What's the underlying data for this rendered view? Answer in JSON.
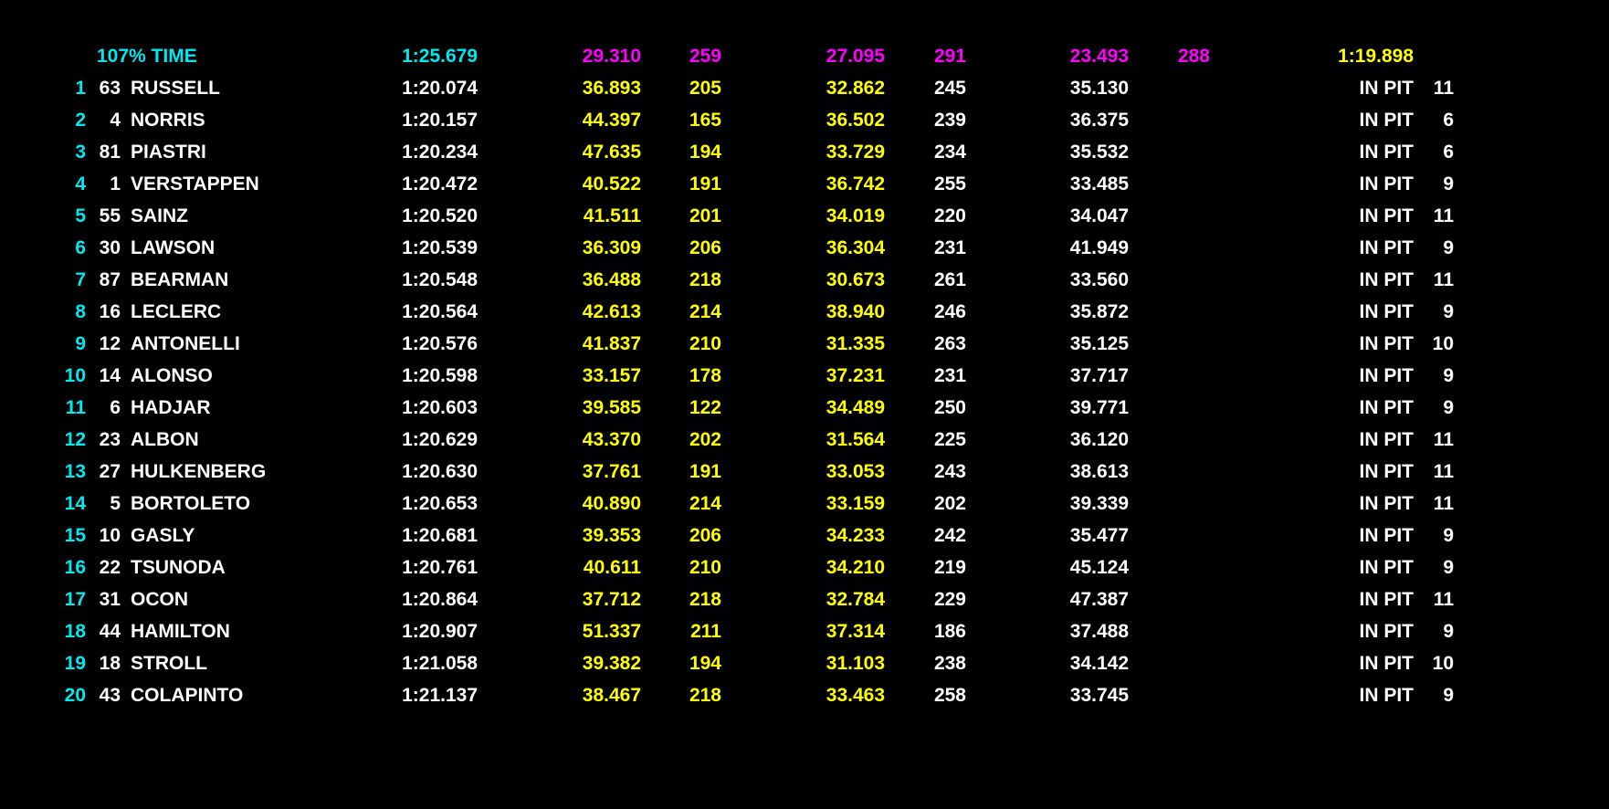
{
  "colors": {
    "background": "#000000",
    "position": "#00e8f0",
    "default_text": "#ffffff",
    "yellow": "#ffff00",
    "magenta": "#ff00ff",
    "cyan": "#00e8f0"
  },
  "reference": {
    "label": "107% TIME",
    "best_time": "1:25.679",
    "sector1": "29.310",
    "speed1": "259",
    "sector2": "27.095",
    "speed2": "291",
    "sector3": "23.493",
    "speed3": "288",
    "ideal_time": "1:19.898"
  },
  "drivers": [
    {
      "pos": "1",
      "num": "63",
      "name": "RUSSELL",
      "best_time": "1:20.074",
      "sector1": "36.893",
      "speed1": "205",
      "sector2": "32.862",
      "speed2": "245",
      "sector3": "35.130",
      "status": "IN PIT",
      "laps": "11"
    },
    {
      "pos": "2",
      "num": "4",
      "name": "NORRIS",
      "best_time": "1:20.157",
      "sector1": "44.397",
      "speed1": "165",
      "sector2": "36.502",
      "speed2": "239",
      "sector3": "36.375",
      "status": "IN PIT",
      "laps": "6"
    },
    {
      "pos": "3",
      "num": "81",
      "name": "PIASTRI",
      "best_time": "1:20.234",
      "sector1": "47.635",
      "speed1": "194",
      "sector2": "33.729",
      "speed2": "234",
      "sector3": "35.532",
      "status": "IN PIT",
      "laps": "6"
    },
    {
      "pos": "4",
      "num": "1",
      "name": "VERSTAPPEN",
      "best_time": "1:20.472",
      "sector1": "40.522",
      "speed1": "191",
      "sector2": "36.742",
      "speed2": "255",
      "sector3": "33.485",
      "status": "IN PIT",
      "laps": "9"
    },
    {
      "pos": "5",
      "num": "55",
      "name": "SAINZ",
      "best_time": "1:20.520",
      "sector1": "41.511",
      "speed1": "201",
      "sector2": "34.019",
      "speed2": "220",
      "sector3": "34.047",
      "status": "IN PIT",
      "laps": "11"
    },
    {
      "pos": "6",
      "num": "30",
      "name": "LAWSON",
      "best_time": "1:20.539",
      "sector1": "36.309",
      "speed1": "206",
      "sector2": "36.304",
      "speed2": "231",
      "sector3": "41.949",
      "status": "IN PIT",
      "laps": "9"
    },
    {
      "pos": "7",
      "num": "87",
      "name": "BEARMAN",
      "best_time": "1:20.548",
      "sector1": "36.488",
      "speed1": "218",
      "sector2": "30.673",
      "speed2": "261",
      "sector3": "33.560",
      "status": "IN PIT",
      "laps": "11"
    },
    {
      "pos": "8",
      "num": "16",
      "name": "LECLERC",
      "best_time": "1:20.564",
      "sector1": "42.613",
      "speed1": "214",
      "sector2": "38.940",
      "speed2": "246",
      "sector3": "35.872",
      "status": "IN PIT",
      "laps": "9"
    },
    {
      "pos": "9",
      "num": "12",
      "name": "ANTONELLI",
      "best_time": "1:20.576",
      "sector1": "41.837",
      "speed1": "210",
      "sector2": "31.335",
      "speed2": "263",
      "sector3": "35.125",
      "status": "IN PIT",
      "laps": "10"
    },
    {
      "pos": "10",
      "num": "14",
      "name": "ALONSO",
      "best_time": "1:20.598",
      "sector1": "33.157",
      "speed1": "178",
      "sector2": "37.231",
      "speed2": "231",
      "sector3": "37.717",
      "status": "IN PIT",
      "laps": "9"
    },
    {
      "pos": "11",
      "num": "6",
      "name": "HADJAR",
      "best_time": "1:20.603",
      "sector1": "39.585",
      "speed1": "122",
      "sector2": "34.489",
      "speed2": "250",
      "sector3": "39.771",
      "status": "IN PIT",
      "laps": "9"
    },
    {
      "pos": "12",
      "num": "23",
      "name": "ALBON",
      "best_time": "1:20.629",
      "sector1": "43.370",
      "speed1": "202",
      "sector2": "31.564",
      "speed2": "225",
      "sector3": "36.120",
      "status": "IN PIT",
      "laps": "11"
    },
    {
      "pos": "13",
      "num": "27",
      "name": "HULKENBERG",
      "best_time": "1:20.630",
      "sector1": "37.761",
      "speed1": "191",
      "sector2": "33.053",
      "speed2": "243",
      "sector3": "38.613",
      "status": "IN PIT",
      "laps": "11"
    },
    {
      "pos": "14",
      "num": "5",
      "name": "BORTOLETO",
      "best_time": "1:20.653",
      "sector1": "40.890",
      "speed1": "214",
      "sector2": "33.159",
      "speed2": "202",
      "sector3": "39.339",
      "status": "IN PIT",
      "laps": "11"
    },
    {
      "pos": "15",
      "num": "10",
      "name": "GASLY",
      "best_time": "1:20.681",
      "sector1": "39.353",
      "speed1": "206",
      "sector2": "34.233",
      "speed2": "242",
      "sector3": "35.477",
      "status": "IN PIT",
      "laps": "9"
    },
    {
      "pos": "16",
      "num": "22",
      "name": "TSUNODA",
      "best_time": "1:20.761",
      "sector1": "40.611",
      "speed1": "210",
      "sector2": "34.210",
      "speed2": "219",
      "sector3": "45.124",
      "status": "IN PIT",
      "laps": "9"
    },
    {
      "pos": "17",
      "num": "31",
      "name": "OCON",
      "best_time": "1:20.864",
      "sector1": "37.712",
      "speed1": "218",
      "sector2": "32.784",
      "speed2": "229",
      "sector3": "47.387",
      "status": "IN PIT",
      "laps": "11"
    },
    {
      "pos": "18",
      "num": "44",
      "name": "HAMILTON",
      "best_time": "1:20.907",
      "sector1": "51.337",
      "speed1": "211",
      "sector2": "37.314",
      "speed2": "186",
      "sector3": "37.488",
      "status": "IN PIT",
      "laps": "9"
    },
    {
      "pos": "19",
      "num": "18",
      "name": "STROLL",
      "best_time": "1:21.058",
      "sector1": "39.382",
      "speed1": "194",
      "sector2": "31.103",
      "speed2": "238",
      "sector3": "34.142",
      "status": "IN PIT",
      "laps": "10"
    },
    {
      "pos": "20",
      "num": "43",
      "name": "COLAPINTO",
      "best_time": "1:21.137",
      "sector1": "38.467",
      "speed1": "218",
      "sector2": "33.463",
      "speed2": "258",
      "sector3": "33.745",
      "status": "IN PIT",
      "laps": "9"
    }
  ]
}
